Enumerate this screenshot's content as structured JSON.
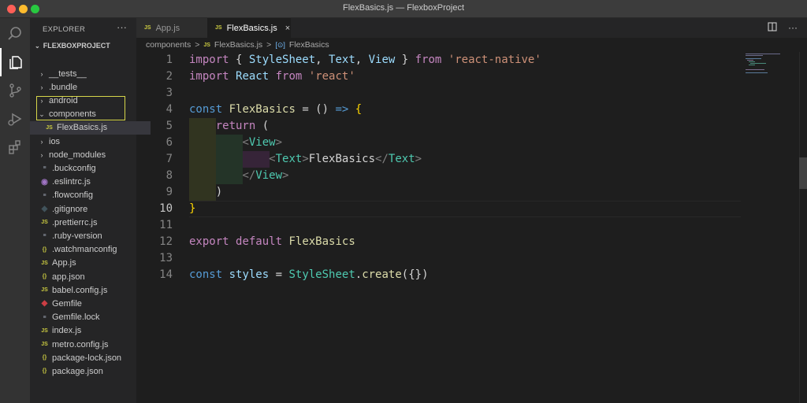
{
  "window": {
    "title": "FlexBasics.js — FlexboxProject"
  },
  "activity_bar": [
    "search-icon",
    "files-icon",
    "source-control-icon",
    "run-debug-icon",
    "extensions-icon"
  ],
  "sidebar": {
    "header": "EXPLORER",
    "more": "···",
    "root": "FLEXBOXPROJECT",
    "items": [
      {
        "label": "__tests__",
        "type": "folder",
        "expanded": false
      },
      {
        "label": ".bundle",
        "type": "folder",
        "expanded": false
      },
      {
        "label": "android",
        "type": "folder",
        "expanded": false
      },
      {
        "label": "components",
        "type": "folder",
        "expanded": true
      },
      {
        "label": "FlexBasics.js",
        "type": "js",
        "selected": true
      },
      {
        "label": "ios",
        "type": "folder",
        "expanded": false
      },
      {
        "label": "node_modules",
        "type": "folder",
        "expanded": false
      },
      {
        "label": ".buckconfig",
        "type": "config"
      },
      {
        "label": ".eslintrc.js",
        "type": "eslint"
      },
      {
        "label": ".flowconfig",
        "type": "config"
      },
      {
        "label": ".gitignore",
        "type": "git"
      },
      {
        "label": ".prettierrc.js",
        "type": "js"
      },
      {
        "label": ".ruby-version",
        "type": "config"
      },
      {
        "label": ".watchmanconfig",
        "type": "json"
      },
      {
        "label": "App.js",
        "type": "js"
      },
      {
        "label": "app.json",
        "type": "json"
      },
      {
        "label": "babel.config.js",
        "type": "js"
      },
      {
        "label": "Gemfile",
        "type": "ruby"
      },
      {
        "label": "Gemfile.lock",
        "type": "config"
      },
      {
        "label": "index.js",
        "type": "js"
      },
      {
        "label": "metro.config.js",
        "type": "js"
      },
      {
        "label": "package-lock.json",
        "type": "json"
      },
      {
        "label": "package.json",
        "type": "json"
      }
    ]
  },
  "tabs": [
    {
      "label": "App.js",
      "badge": "JS",
      "active": false
    },
    {
      "label": "FlexBasics.js",
      "badge": "JS",
      "active": true,
      "close": "×"
    }
  ],
  "breadcrumb": {
    "folder": "components",
    "sep": ">",
    "file": "FlexBasics.js",
    "badge": "JS",
    "symbol_icon": "[⊙]",
    "symbol": "FlexBasics"
  },
  "editor": {
    "line_numbers": [
      "1",
      "2",
      "3",
      "4",
      "5",
      "6",
      "7",
      "8",
      "9",
      "10",
      "11",
      "12",
      "13",
      "14"
    ],
    "current_line": "10",
    "lines": [
      [
        [
          "kw",
          "import"
        ],
        [
          "p",
          " { "
        ],
        [
          "vr",
          "StyleSheet"
        ],
        [
          "p",
          ", "
        ],
        [
          "vr",
          "Text"
        ],
        [
          "p",
          ", "
        ],
        [
          "vr",
          "View"
        ],
        [
          "p",
          " } "
        ],
        [
          "kw",
          "from"
        ],
        [
          "p",
          " "
        ],
        [
          "st",
          "'react-native'"
        ]
      ],
      [
        [
          "kw",
          "import"
        ],
        [
          "p",
          " "
        ],
        [
          "vr",
          "React"
        ],
        [
          "p",
          " "
        ],
        [
          "kw",
          "from"
        ],
        [
          "p",
          " "
        ],
        [
          "st",
          "'react'"
        ]
      ],
      [],
      [
        [
          "sb",
          "const"
        ],
        [
          "p",
          " "
        ],
        [
          "fn",
          "FlexBasics"
        ],
        [
          "p",
          " = () "
        ],
        [
          "sb",
          "=>"
        ],
        [
          "p",
          " "
        ],
        [
          "br",
          "{"
        ]
      ],
      [
        [
          "p",
          "    "
        ],
        [
          "kw",
          "return"
        ],
        [
          "p",
          " ("
        ]
      ],
      [
        [
          "p",
          "        "
        ],
        [
          "tg",
          "<"
        ],
        [
          "ty",
          "View"
        ],
        [
          "tg",
          ">"
        ]
      ],
      [
        [
          "p",
          "            "
        ],
        [
          "tg",
          "<"
        ],
        [
          "ty",
          "Text"
        ],
        [
          "tg",
          ">"
        ],
        [
          "p",
          "FlexBasics"
        ],
        [
          "tg",
          "</"
        ],
        [
          "ty",
          "Text"
        ],
        [
          "tg",
          ">"
        ]
      ],
      [
        [
          "p",
          "        "
        ],
        [
          "tg",
          "</"
        ],
        [
          "ty",
          "View"
        ],
        [
          "tg",
          ">"
        ]
      ],
      [
        [
          "p",
          "    )"
        ]
      ],
      [
        [
          "br",
          "}"
        ]
      ],
      [],
      [
        [
          "kw",
          "export"
        ],
        [
          "p",
          " "
        ],
        [
          "kw",
          "default"
        ],
        [
          "p",
          " "
        ],
        [
          "fn",
          "FlexBasics"
        ]
      ],
      [],
      [
        [
          "sb",
          "const"
        ],
        [
          "p",
          " "
        ],
        [
          "vr",
          "styles"
        ],
        [
          "p",
          " = "
        ],
        [
          "ty",
          "StyleSheet"
        ],
        [
          "p",
          "."
        ],
        [
          "fn",
          "create"
        ],
        [
          "p",
          "({})"
        ]
      ]
    ]
  },
  "colors": {
    "background": "#1e1e1e",
    "sidebar": "#252526",
    "activity_bar": "#333333",
    "highlight_box": "#d6d64a",
    "js_badge": "#cbcb41"
  }
}
